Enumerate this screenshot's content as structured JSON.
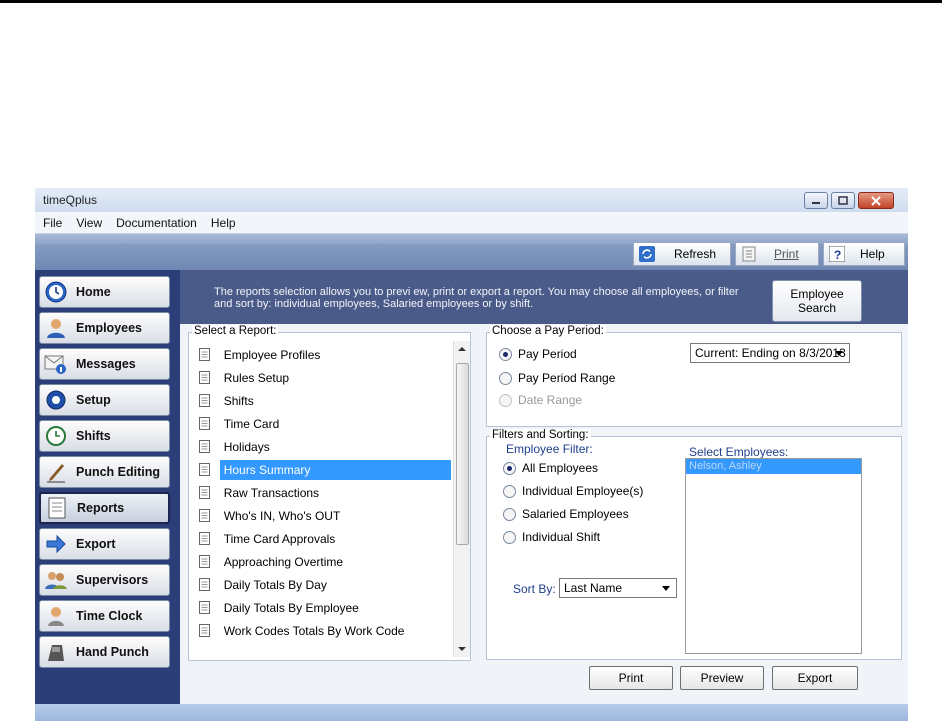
{
  "window": {
    "title": "timeQplus"
  },
  "menu": [
    "File",
    "View",
    "Documentation",
    "Help"
  ],
  "toolbar": {
    "refresh": "Refresh",
    "print": "Print",
    "help": "Help"
  },
  "nav": [
    {
      "label": "Home",
      "icon": "clock-icon"
    },
    {
      "label": "Employees",
      "icon": "person-icon"
    },
    {
      "label": "Messages",
      "icon": "envelope-icon"
    },
    {
      "label": "Setup",
      "icon": "gear-icon"
    },
    {
      "label": "Shifts",
      "icon": "shift-clock-icon"
    },
    {
      "label": "Punch Editing",
      "icon": "pencil-icon"
    },
    {
      "label": "Reports",
      "icon": "report-icon"
    },
    {
      "label": "Export",
      "icon": "arrow-right-icon"
    },
    {
      "label": "Supervisors",
      "icon": "people-icon"
    },
    {
      "label": "Time Clock",
      "icon": "time-clock-icon"
    },
    {
      "label": "Hand Punch",
      "icon": "hand-icon"
    }
  ],
  "active_nav": "Reports",
  "info": {
    "text": "The reports selection allows you to previ ew, print or export a report. You may choose all employees, or filter and sort by: individual employees, Salaried employees or by shift.",
    "employee_search": "Employee Search"
  },
  "reports": {
    "legend": "Select a Report:",
    "items": [
      "Employee Profiles",
      "Rules Setup",
      "Shifts",
      "Time Card",
      "Holidays",
      "Hours Summary",
      "Raw Transactions",
      "Who's IN, Who's OUT",
      "Time Card Approvals",
      "Approaching Overtime",
      "Daily Totals By Day",
      "Daily Totals By Employee",
      "Work Codes Totals By Work Code"
    ],
    "selected": "Hours Summary"
  },
  "pay_period": {
    "legend": "Choose a Pay Period:",
    "options": [
      "Pay Period",
      "Pay Period Range",
      "Date Range"
    ],
    "selected": "Pay Period",
    "current": "Current:  Ending on 8/3/2013"
  },
  "filters": {
    "legend": "Filters and Sorting:",
    "employee_filter_label": "Employee Filter:",
    "options": [
      "All Employees",
      "Individual Employee(s)",
      "Salaried Employees",
      "Individual Shift"
    ],
    "selected": "All Employees",
    "sort_by_label": "Sort By:",
    "sort_by_value": "Last Name",
    "select_employees_label": "Select Employees:",
    "employees": [
      "Nelson, Ashley"
    ]
  },
  "buttons": {
    "print": "Print",
    "preview": "Preview",
    "export": "Export"
  },
  "colors": {
    "sidebar": "#2b3e78",
    "info_bar": "#4a5b89",
    "selection": "#3399ff"
  }
}
